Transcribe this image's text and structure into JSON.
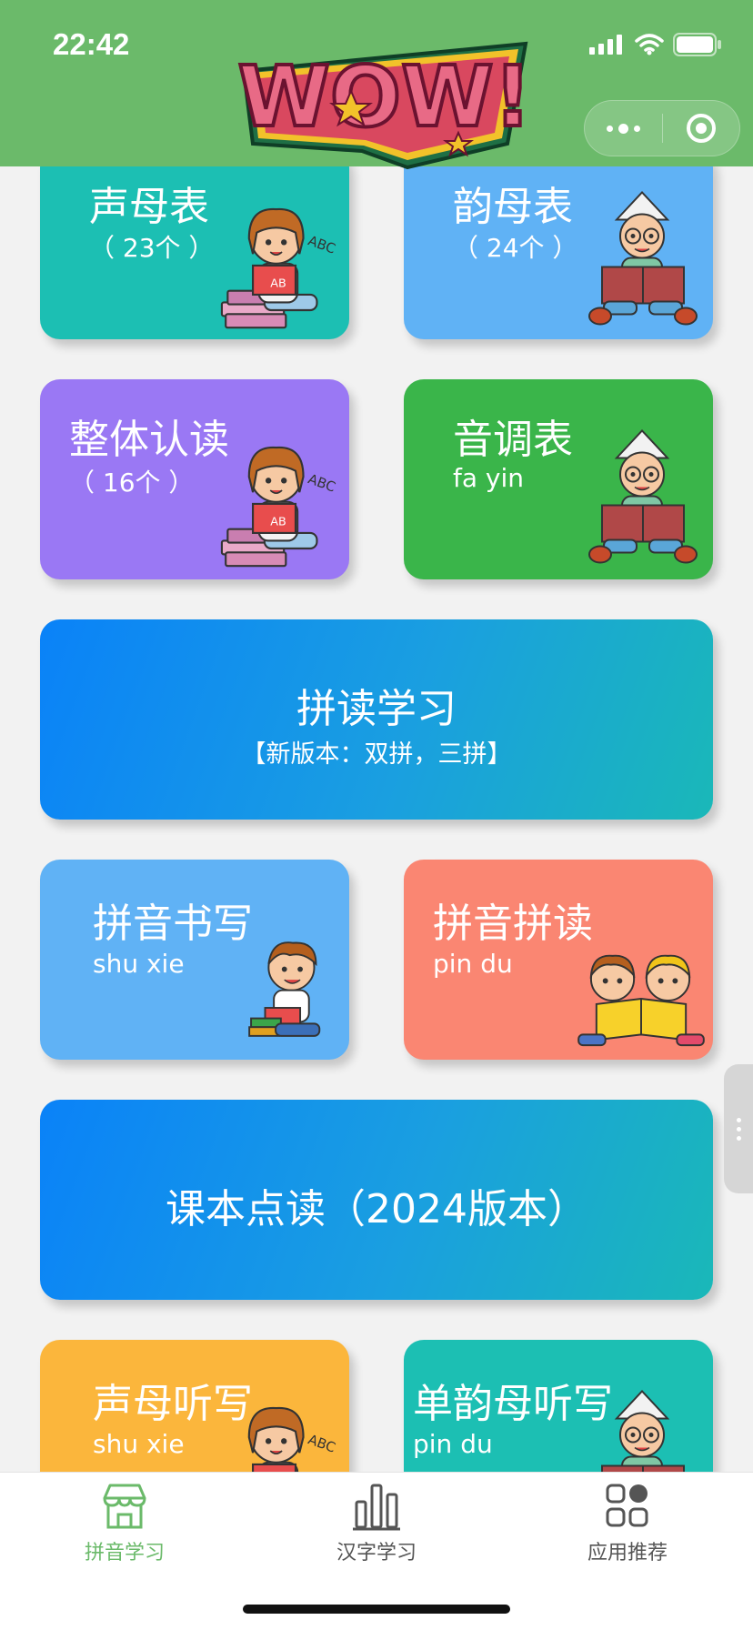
{
  "status_bar": {
    "time": "22:42"
  },
  "header": {
    "logo_text": "WOW!"
  },
  "cards": {
    "shengmu": {
      "title": "声母表",
      "sub": "（ 23个 ）"
    },
    "yunmu": {
      "title": "韵母表",
      "sub": "（ 24个 ）"
    },
    "zhengti": {
      "title": "整体认读",
      "sub": "（ 16个 ）"
    },
    "yindiao": {
      "title": "音调表",
      "sub": "fa yin"
    },
    "pindu_study": {
      "title": "拼读学习",
      "sub": "【新版本：双拼，三拼】"
    },
    "pinyin_write": {
      "title": "拼音书写",
      "sub": "shu xie"
    },
    "pinyin_read": {
      "title": "拼音拼读",
      "sub": "pin du"
    },
    "textbook": {
      "title": "课本点读（2024版本）"
    },
    "shengmu_dictation": {
      "title": "声母听写",
      "sub": "shu xie"
    },
    "danyunmu_dictation": {
      "title": "单韵母听写",
      "sub": "pin du"
    }
  },
  "tabbar": {
    "tabs": [
      {
        "label": "拼音学习",
        "active": true
      },
      {
        "label": "汉字学习",
        "active": false
      },
      {
        "label": "应用推荐",
        "active": false
      }
    ]
  },
  "colors": {
    "header_green": "#6bba6a",
    "teal": "#1cbfb3",
    "blue": "#60b2f5",
    "purple": "#9a78f4",
    "green": "#3ab54a",
    "salmon": "#fa8672",
    "orange": "#fbb63c"
  }
}
